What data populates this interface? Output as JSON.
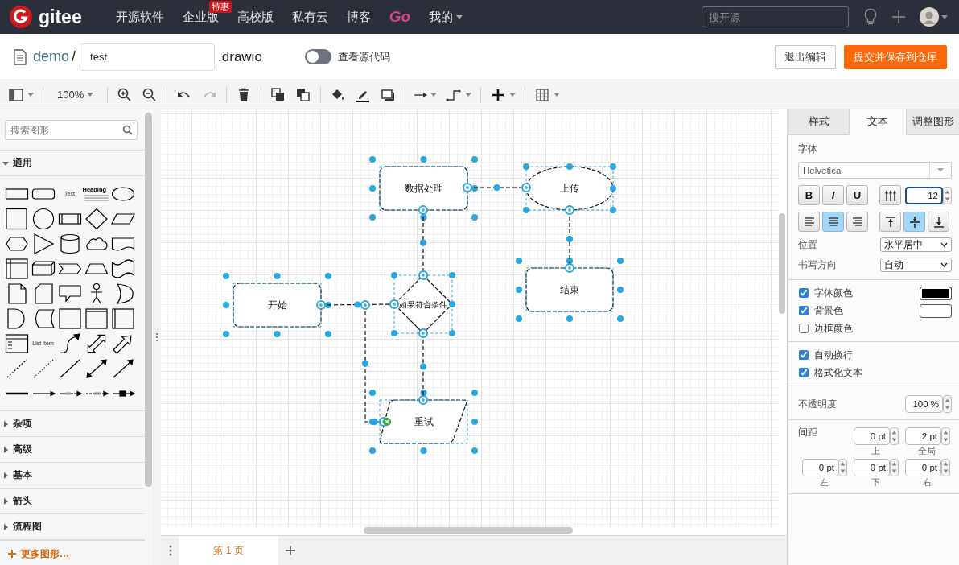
{
  "header": {
    "logo": "gitee",
    "nav": [
      {
        "label": "开源软件",
        "kind": "link"
      },
      {
        "label": "企业版",
        "kind": "link",
        "badge": "特惠"
      },
      {
        "label": "高校版",
        "kind": "link"
      },
      {
        "label": "私有云",
        "kind": "link"
      },
      {
        "label": "博客",
        "kind": "link"
      },
      {
        "label": "Go",
        "kind": "brand"
      },
      {
        "label": "我的",
        "kind": "menu"
      }
    ],
    "search": {
      "placeholder": "搜开源"
    }
  },
  "file_bar": {
    "repo": "demo",
    "separator": "/",
    "filename": "test",
    "extension": ".drawio",
    "source_toggle": {
      "label": "查看源代码",
      "on": false
    },
    "buttons": [
      {
        "label": "退出编辑",
        "kind": "secondary"
      },
      {
        "label": "提交并保存到仓库",
        "kind": "primary"
      }
    ]
  },
  "toolbar": {
    "groups": [
      [
        {
          "kind": "layout",
          "dropdown": true,
          "disabled": false
        }
      ],
      [
        {
          "kind": "zoom-level",
          "label": "100%",
          "dropdown": true,
          "disabled": false
        }
      ],
      [
        {
          "kind": "zoom-in",
          "dropdown": false,
          "disabled": false
        },
        {
          "kind": "zoom-out",
          "dropdown": false,
          "disabled": false
        }
      ],
      [
        {
          "kind": "undo",
          "dropdown": false,
          "disabled": false
        },
        {
          "kind": "redo",
          "dropdown": false,
          "disabled": true
        }
      ],
      [
        {
          "kind": "delete",
          "dropdown": false,
          "disabled": false
        }
      ],
      [
        {
          "kind": "to-front",
          "dropdown": false,
          "disabled": false
        },
        {
          "kind": "to-back",
          "dropdown": false,
          "disabled": false
        }
      ],
      [
        {
          "kind": "fill-color",
          "dropdown": false,
          "disabled": false
        },
        {
          "kind": "line-color",
          "dropdown": false,
          "disabled": false
        },
        {
          "kind": "shadow",
          "dropdown": false,
          "disabled": false
        }
      ],
      [
        {
          "kind": "connection",
          "dropdown": true,
          "disabled": false
        },
        {
          "kind": "waypoints",
          "dropdown": true,
          "disabled": false
        }
      ],
      [
        {
          "kind": "insert",
          "dropdown": true,
          "disabled": false
        }
      ],
      [
        {
          "kind": "table",
          "dropdown": true,
          "disabled": false
        }
      ]
    ]
  },
  "shape_panel": {
    "search": {
      "placeholder": "搜索图形"
    },
    "sections": [
      {
        "title": "通用",
        "expanded": true
      },
      {
        "title": "杂项",
        "expanded": false
      },
      {
        "title": "高级",
        "expanded": false
      },
      {
        "title": "基本",
        "expanded": false
      },
      {
        "title": "箭头",
        "expanded": false
      },
      {
        "title": "流程图",
        "expanded": false
      }
    ],
    "shapes": [
      {
        "kind": "rect"
      },
      {
        "kind": "rounded"
      },
      {
        "kind": "text",
        "label": "Text"
      },
      {
        "kind": "heading",
        "label": "Heading"
      },
      {
        "kind": "ellipse"
      },
      {
        "kind": "square"
      },
      {
        "kind": "circle"
      },
      {
        "kind": "process"
      },
      {
        "kind": "diamond"
      },
      {
        "kind": "parallelogram"
      },
      {
        "kind": "hexagon"
      },
      {
        "kind": "triangle"
      },
      {
        "kind": "cylinder"
      },
      {
        "kind": "cloud"
      },
      {
        "kind": "document"
      },
      {
        "kind": "internal_storage"
      },
      {
        "kind": "cube"
      },
      {
        "kind": "step"
      },
      {
        "kind": "trapezoid"
      },
      {
        "kind": "tape"
      },
      {
        "kind": "note"
      },
      {
        "kind": "card"
      },
      {
        "kind": "callout"
      },
      {
        "kind": "actor"
      },
      {
        "kind": "or"
      },
      {
        "kind": "delay"
      },
      {
        "kind": "data_storage"
      },
      {
        "kind": "square_plain"
      },
      {
        "kind": "frame"
      },
      {
        "kind": "container"
      },
      {
        "kind": "list"
      },
      {
        "kind": "list_item",
        "label": "List Item"
      },
      {
        "kind": "curve"
      },
      {
        "kind": "bidir_arrow"
      },
      {
        "kind": "arrow"
      },
      {
        "kind": "dashed"
      },
      {
        "kind": "dotted"
      },
      {
        "kind": "line"
      },
      {
        "kind": "bidir_conn"
      },
      {
        "kind": "conn"
      },
      {
        "kind": "link"
      },
      {
        "kind": "connector"
      },
      {
        "kind": "labeled"
      },
      {
        "kind": "labeled2"
      },
      {
        "kind": "labeled3"
      }
    ],
    "more": "更多图形…"
  },
  "diagram": {
    "nodes": [
      {
        "label": "数据处理",
        "kind": "rounded",
        "selected": true
      },
      {
        "label": "上传",
        "kind": "ellipse",
        "selected": true
      },
      {
        "label": "开始",
        "kind": "rounded",
        "selected": true
      },
      {
        "label": "如果符合条件",
        "kind": "diamond",
        "selected": true
      },
      {
        "label": "结束",
        "kind": "rounded",
        "selected": true
      },
      {
        "label": "重试",
        "kind": "parallelogram",
        "selected": true
      }
    ],
    "edges": [
      {
        "selected": true
      },
      {
        "selected": true
      },
      {
        "selected": true
      },
      {
        "selected": true
      },
      {
        "selected": true
      },
      {
        "selected": true
      }
    ]
  },
  "pages": {
    "tabs": [
      {
        "label": "第 1 页",
        "selected": true
      }
    ]
  },
  "format_panel": {
    "tabs": [
      {
        "label": "样式",
        "selected": false
      },
      {
        "label": "文本",
        "selected": true
      },
      {
        "label": "调整图形",
        "selected": false
      }
    ],
    "font": {
      "title": "字体",
      "family": "Helvetica",
      "styles": [
        {
          "label": "B",
          "kind": "bold",
          "selected": false
        },
        {
          "label": "I",
          "kind": "italic",
          "selected": false
        },
        {
          "label": "U",
          "kind": "underline",
          "selected": false
        }
      ],
      "vertical": {
        "selected": false
      },
      "size": "12"
    },
    "align": [
      {
        "kind": "left",
        "selected": false
      },
      {
        "kind": "center",
        "selected": true
      },
      {
        "kind": "right",
        "selected": false
      }
    ],
    "valign": [
      {
        "kind": "top",
        "selected": false
      },
      {
        "kind": "middle",
        "selected": true
      },
      {
        "kind": "bottom",
        "selected": false
      }
    ],
    "selects": [
      {
        "label": "位置",
        "value": "水平居中"
      },
      {
        "label": "书写方向",
        "value": "自动"
      }
    ],
    "colors": [
      {
        "label": "字体颜色",
        "checked": true,
        "color": "#000000"
      },
      {
        "label": "背景色",
        "checked": true,
        "color": "#ffffff"
      },
      {
        "label": "边框颜色",
        "checked": false
      }
    ],
    "options": [
      {
        "label": "自动换行",
        "checked": true
      },
      {
        "label": "格式化文本",
        "checked": true
      }
    ],
    "opacity": {
      "label": "不透明度",
      "value": "100 %"
    },
    "spacing": {
      "label": "间距",
      "rows": [
        [
          "",
          {
            "value": "0 pt",
            "caption": "上"
          },
          {
            "value": "2 pt",
            "caption": "全局"
          }
        ],
        [
          {
            "value": "0 pt",
            "caption": "左"
          },
          {
            "value": "0 pt",
            "caption": "下"
          },
          {
            "value": "0 pt",
            "caption": "右"
          }
        ]
      ]
    }
  }
}
